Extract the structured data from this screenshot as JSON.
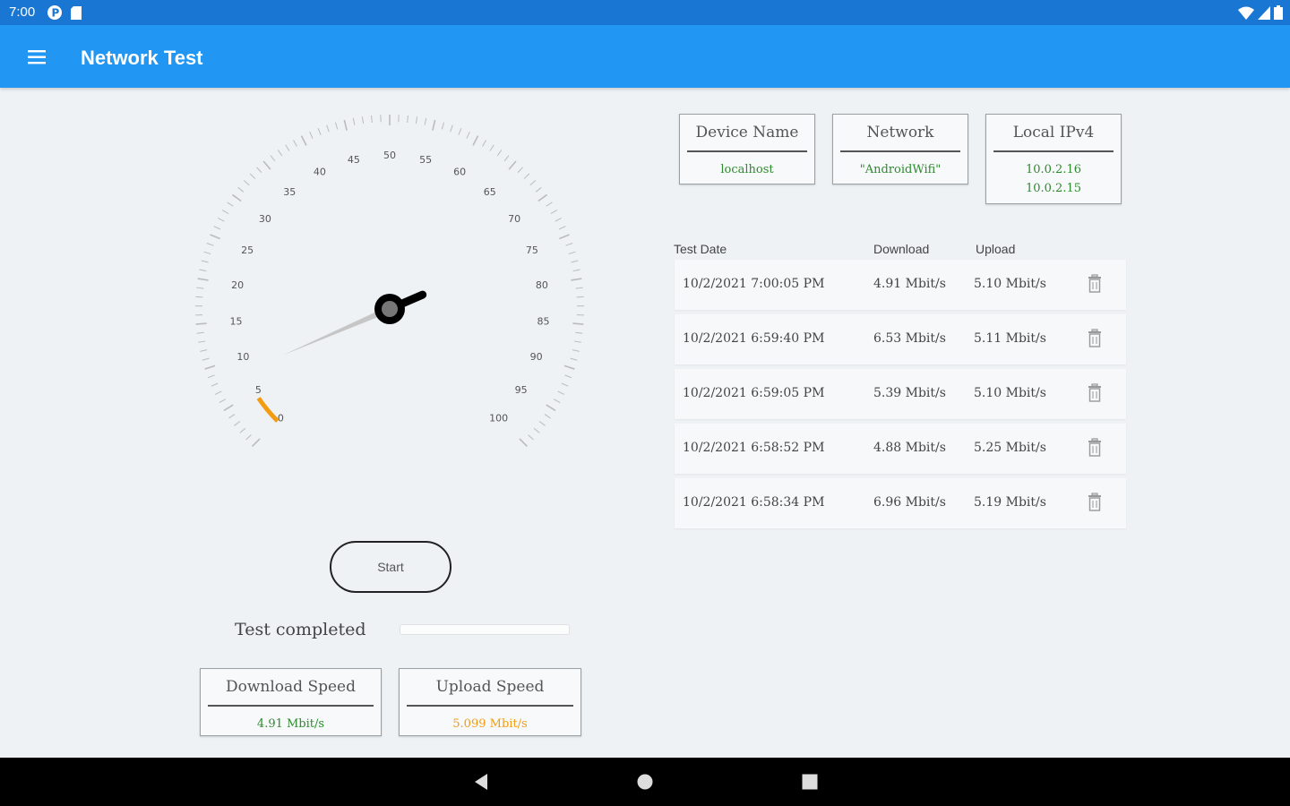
{
  "status_bar": {
    "time": "7:00",
    "icons": [
      "p-badge-icon",
      "sd-card-icon",
      "wifi-icon",
      "signal-icon",
      "battery-icon"
    ]
  },
  "app_bar": {
    "title": "Network Test",
    "menu_icon": "hamburger-menu-icon"
  },
  "gauge": {
    "min": 0,
    "max": 100,
    "tick_labels": [
      "0",
      "5",
      "10",
      "15",
      "20",
      "25",
      "30",
      "35",
      "40",
      "45",
      "50",
      "55",
      "60",
      "65",
      "70",
      "75",
      "80",
      "85",
      "90",
      "95",
      "100"
    ],
    "progress_value": 4,
    "needle_value": 8,
    "accent_color": "#f39c12"
  },
  "start_button_label": "Start",
  "status_text": "Test completed",
  "progress_fraction": 1.0,
  "info_cards": {
    "device_name": {
      "title": "Device Name",
      "value": "localhost"
    },
    "network": {
      "title": "Network",
      "value": "\"AndroidWifi\""
    },
    "local_ipv4": {
      "title": "Local IPv4",
      "values": [
        "10.0.2.16",
        "10.0.2.15"
      ]
    }
  },
  "results": {
    "headers": {
      "date": "Test Date",
      "download": "Download",
      "upload": "Upload"
    },
    "rows": [
      {
        "date": "10/2/2021 7:00:05 PM",
        "download": "4.91 Mbit/s",
        "upload": "5.10 Mbit/s"
      },
      {
        "date": "10/2/2021 6:59:40 PM",
        "download": "6.53 Mbit/s",
        "upload": "5.11 Mbit/s"
      },
      {
        "date": "10/2/2021 6:59:05 PM",
        "download": "5.39 Mbit/s",
        "upload": "5.10 Mbit/s"
      },
      {
        "date": "10/2/2021 6:58:52 PM",
        "download": "4.88 Mbit/s",
        "upload": "5.25 Mbit/s"
      },
      {
        "date": "10/2/2021 6:58:34 PM",
        "download": "6.96 Mbit/s",
        "upload": "5.19 Mbit/s"
      }
    ],
    "delete_icon": "trash-icon"
  },
  "speed_cards": {
    "download": {
      "title": "Download Speed",
      "value": "4.91 Mbit/s"
    },
    "upload": {
      "title": "Upload Speed",
      "value": "5.099 Mbit/s"
    }
  },
  "colors": {
    "status_bar": "#1976d2",
    "app_bar": "#2196f3",
    "value_green": "#2e8b2e",
    "value_orange": "#f39c12",
    "background": "#eef2f5"
  },
  "nav_bar": {
    "buttons": [
      "back-icon",
      "home-icon",
      "recents-icon"
    ]
  }
}
